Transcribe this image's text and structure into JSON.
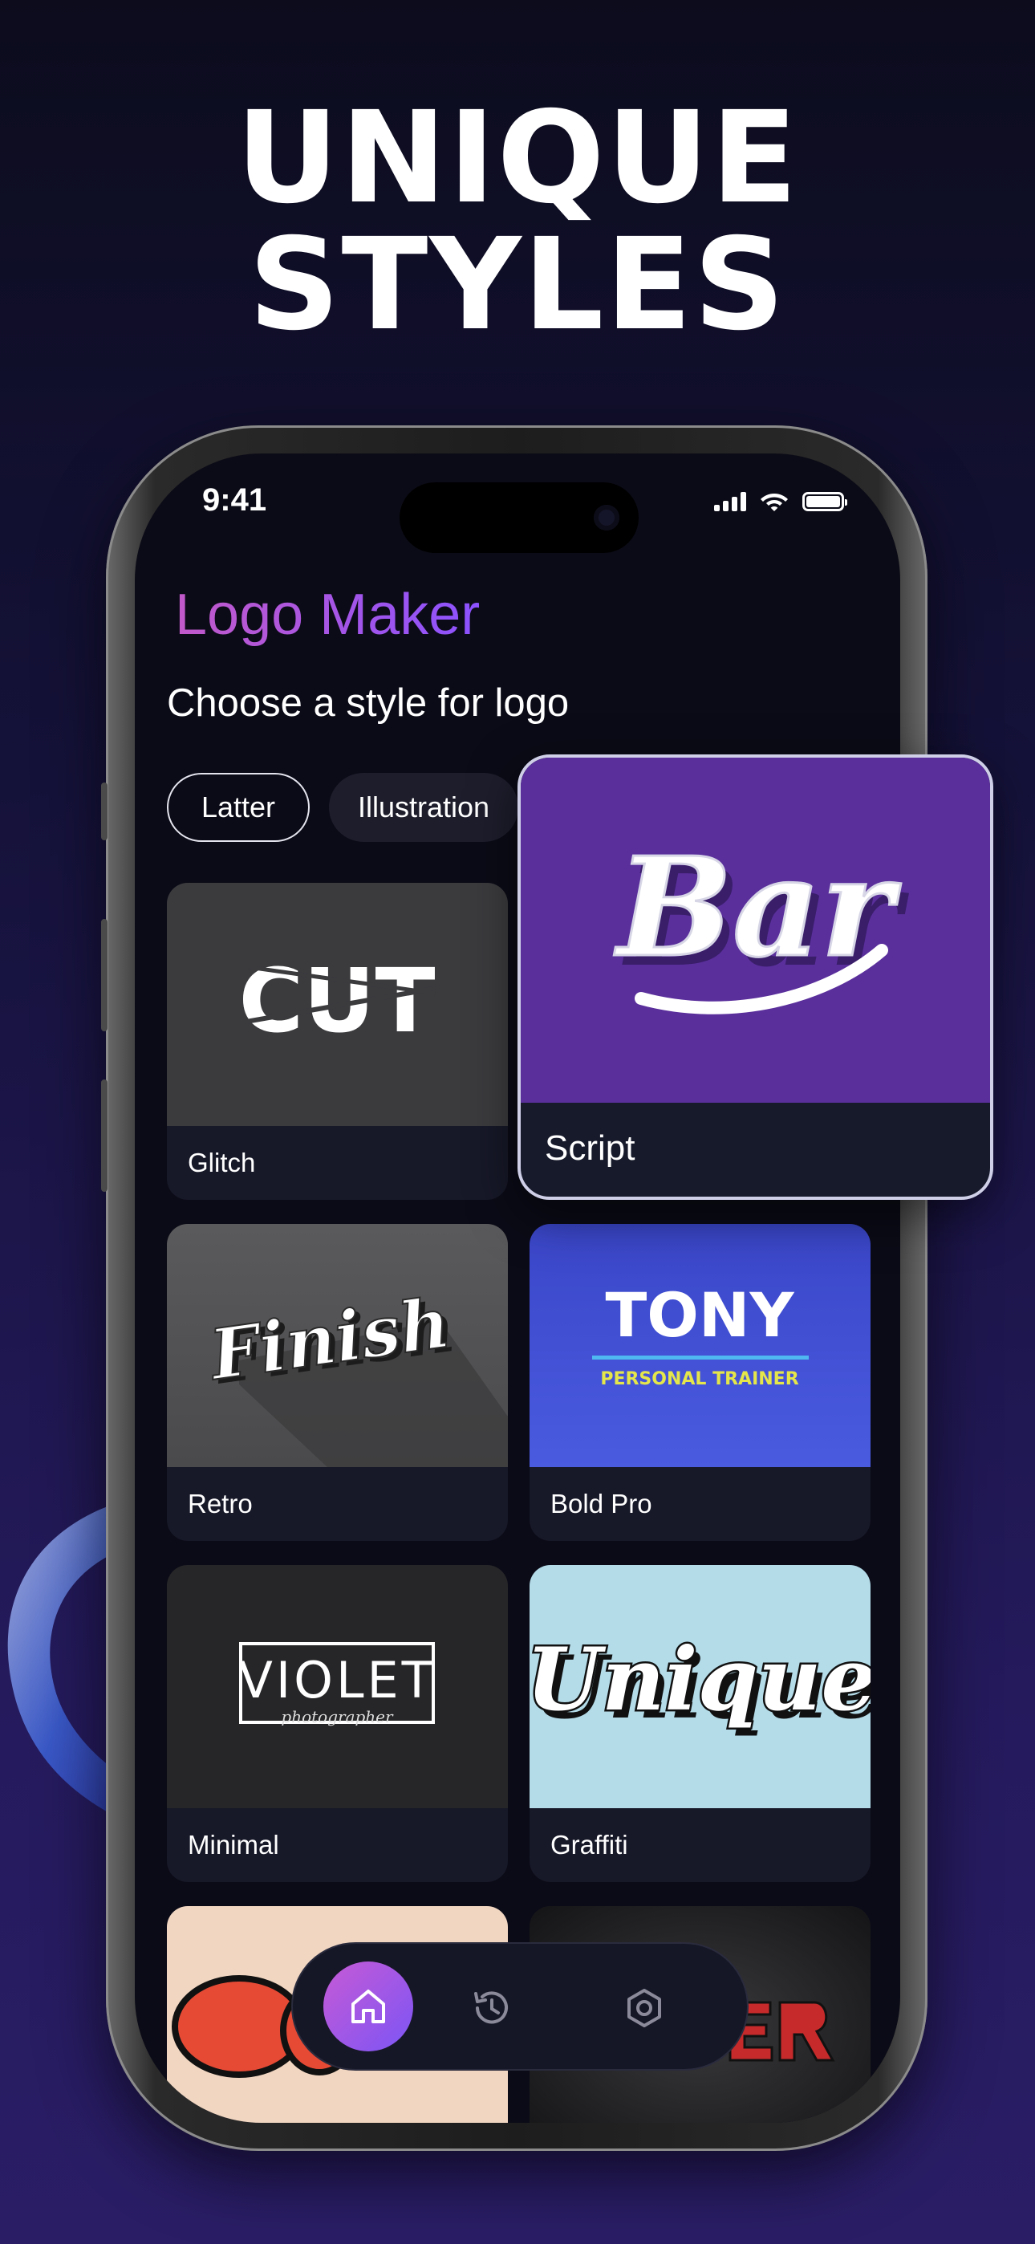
{
  "headline": "UNIQUE STYLES",
  "status_bar": {
    "time": "9:41"
  },
  "app": {
    "title": "Logo Maker",
    "subtitle": "Choose a style for logo",
    "filters": [
      "Latter",
      "Illustration"
    ],
    "styles": [
      {
        "label": "Glitch",
        "preview_text": "CUT"
      },
      {
        "label": "Retro",
        "preview_text": "Finish"
      },
      {
        "label": "Bold Pro",
        "preview_text": "TONY",
        "preview_subtext": "PERSONAL TRAINER"
      },
      {
        "label": "Minimal",
        "preview_text": "VIOLET",
        "preview_subtext": "photographer"
      },
      {
        "label": "Graffiti",
        "preview_text": "Unique"
      }
    ],
    "featured": {
      "label": "Script",
      "preview_text": "Bar"
    },
    "nav": [
      {
        "name": "home",
        "icon": "home-icon",
        "active": true
      },
      {
        "name": "history",
        "icon": "history-icon",
        "active": false
      },
      {
        "name": "settings",
        "icon": "settings-icon",
        "active": false
      }
    ]
  },
  "colors": {
    "accent_start": "#c75ad6",
    "accent_end": "#7b55f5",
    "script_bg": "#5a2f9c",
    "bold_pro_bg": "#3f4fd6",
    "graffiti_bg": "#b3dbe8"
  }
}
